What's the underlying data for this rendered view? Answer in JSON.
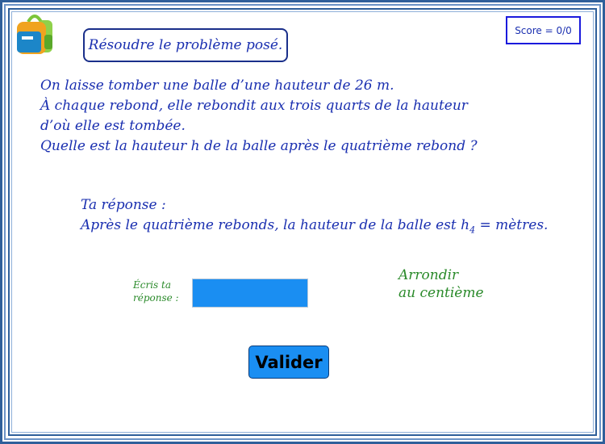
{
  "prompt": "Résoudre le problème posé.",
  "score": "Score = 0/0",
  "problem_lines": [
    "On laisse tomber une balle d’une hauteur de 26 m.",
    "À chaque rebond, elle rebondit aux trois quarts de la hauteur",
    "d’où elle est tombée.",
    "Quelle est la hauteur h de la balle après le quatrième rebond ?"
  ],
  "answer": {
    "heading": "Ta réponse :",
    "sentence_before": "Après le quatrième rebonds, la hauteur de la balle est h",
    "subscript": "4",
    "sentence_after": " =  mètres."
  },
  "input_label": [
    "Écris ta",
    "réponse :"
  ],
  "input_value": "",
  "rounding_note": [
    "Arrondir",
    "au centième"
  ],
  "validate_label": "Valider",
  "icons": {
    "logo": "backpack-icon"
  },
  "colors": {
    "text_blue": "#1a2fb0",
    "text_green": "#2a8a2a",
    "accent": "#1a8ef2",
    "frame": "#2f5f9a"
  }
}
